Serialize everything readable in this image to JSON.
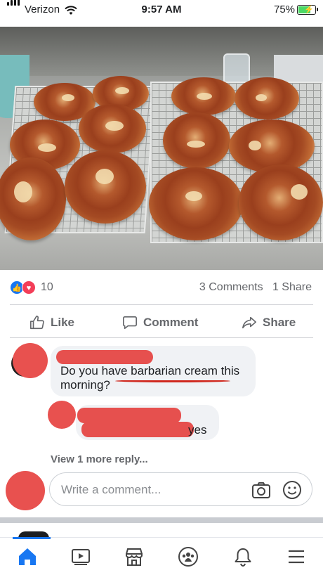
{
  "status_bar": {
    "carrier": "Verizon",
    "time": "9:57 AM",
    "battery_percent": "75%",
    "battery_level": 0.75,
    "icons": [
      "signal-bars-icon",
      "wifi-icon",
      "battery-charging-icon"
    ]
  },
  "post": {
    "photo_description_icon": "donut-tray-photo",
    "reactions": {
      "count": "10",
      "icons": [
        "like-reaction-icon",
        "love-reaction-icon"
      ],
      "comments": "3 Comments",
      "shares": "1 Share"
    },
    "actions": {
      "like": "Like",
      "comment": "Comment",
      "share": "Share"
    }
  },
  "comments": [
    {
      "text": "Do you have barbarian cream this morning?"
    },
    {
      "text": "yes"
    }
  ],
  "view_more": "View 1 more reply...",
  "composer": {
    "placeholder": "Write a comment...",
    "icons": [
      "camera-icon",
      "emoji-icon"
    ]
  },
  "tab_bar": {
    "items": [
      "home-icon",
      "watch-icon",
      "marketplace-icon",
      "groups-icon",
      "notifications-icon",
      "menu-icon"
    ],
    "active": "home-icon",
    "accent": "#1877f2"
  },
  "colors": {
    "accent": "#1877f2",
    "love": "#f33e58",
    "redaction": "#e8514f",
    "muted_text": "#65676b"
  }
}
